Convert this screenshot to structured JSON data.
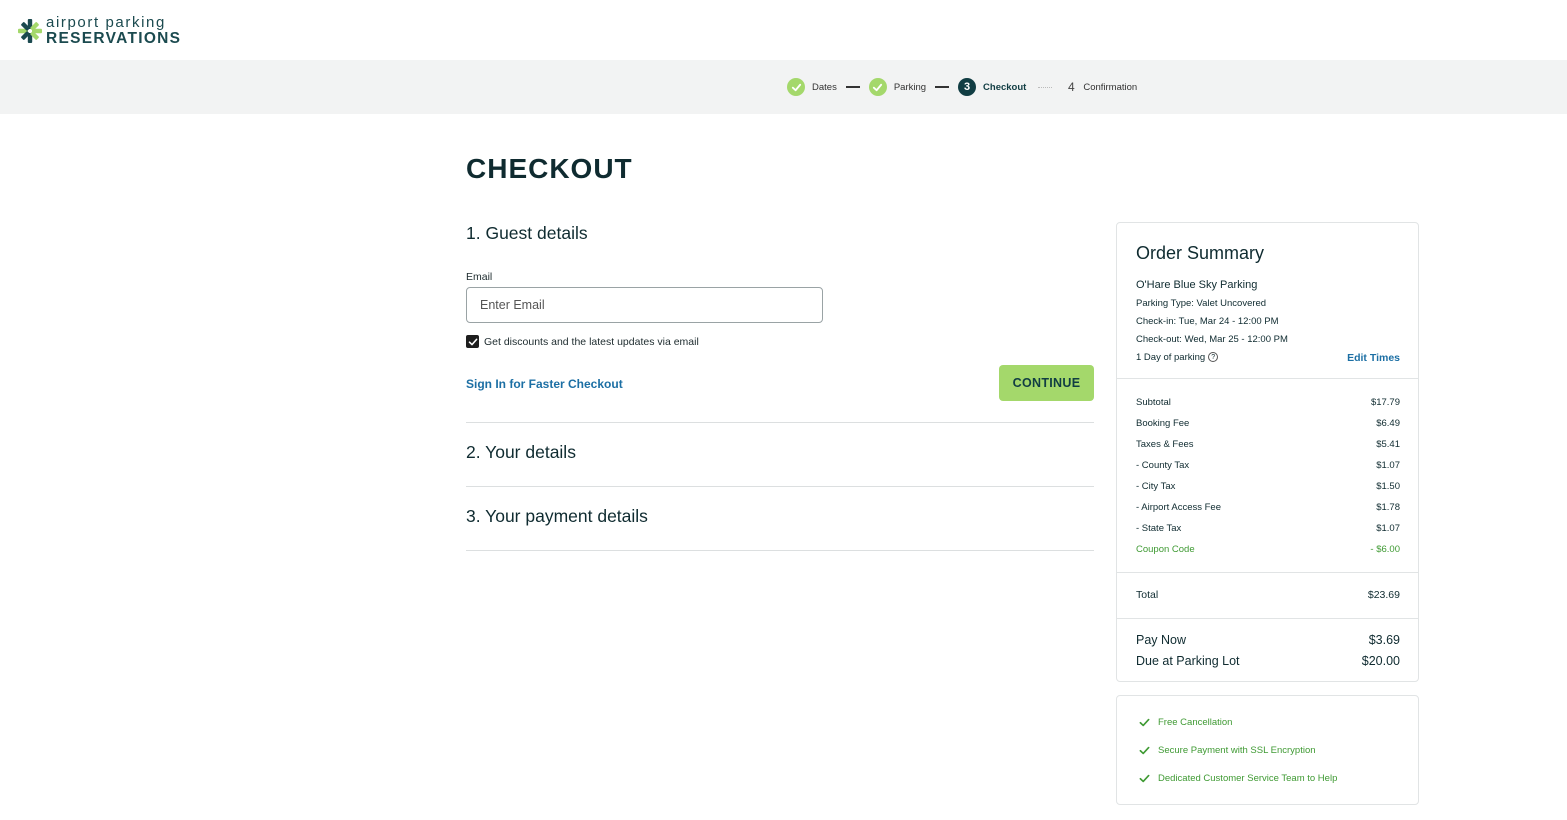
{
  "brand": {
    "top": "airport parking",
    "bottom": "RESERVATIONS",
    "accent": "#a4d86b",
    "dark": "#113d43",
    "link": "#1c6fa4",
    "success": "#3f9a33"
  },
  "steps": [
    {
      "label": "Dates",
      "state": "done"
    },
    {
      "label": "Parking",
      "state": "done"
    },
    {
      "number": "3",
      "label": "Checkout",
      "state": "active"
    },
    {
      "number": "4",
      "label": "Confirmation",
      "state": "pending"
    }
  ],
  "page_title": "CHECKOUT",
  "guest": {
    "heading": "1. Guest details",
    "email_label": "Email",
    "email_placeholder": "Enter Email",
    "email_value": "",
    "opt_in_label": "Get discounts and the latest updates via email",
    "opt_in_checked": true,
    "signin_link": "Sign In for Faster Checkout",
    "continue_label": "CONTINUE"
  },
  "your_details_heading": "2. Your details",
  "payment_heading": "3. Your payment details",
  "summary": {
    "title": "Order Summary",
    "lot_name": "O'Hare Blue Sky Parking",
    "parking_type": "Parking Type: Valet Uncovered",
    "check_in": "Check-in: Tue, Mar 24 - 12:00 PM",
    "check_out": "Check-out: Wed, Mar 25 - 12:00 PM",
    "duration": "1 Day of parking",
    "help_glyph": "?",
    "edit_times": "Edit Times",
    "fees": [
      {
        "label": "Subtotal",
        "value": "$17.79"
      },
      {
        "label": "Booking Fee",
        "value": "$6.49"
      },
      {
        "label": "Taxes & Fees",
        "value": "$5.41"
      },
      {
        "label": "- County Tax",
        "value": "$1.07"
      },
      {
        "label": "- City Tax",
        "value": "$1.50"
      },
      {
        "label": "- Airport Access Fee",
        "value": "$1.78"
      },
      {
        "label": "- State Tax",
        "value": "$1.07"
      },
      {
        "label": "Coupon Code",
        "value": "- $6.00"
      }
    ],
    "total_label": "Total",
    "total_value": "$23.69",
    "pay_now_label": "Pay Now",
    "pay_now_value": "$3.69",
    "due_label": "Due at Parking Lot",
    "due_value": "$20.00"
  },
  "benefits": [
    "Free Cancellation",
    "Secure Payment with SSL Encryption",
    "Dedicated Customer Service Team to Help"
  ]
}
